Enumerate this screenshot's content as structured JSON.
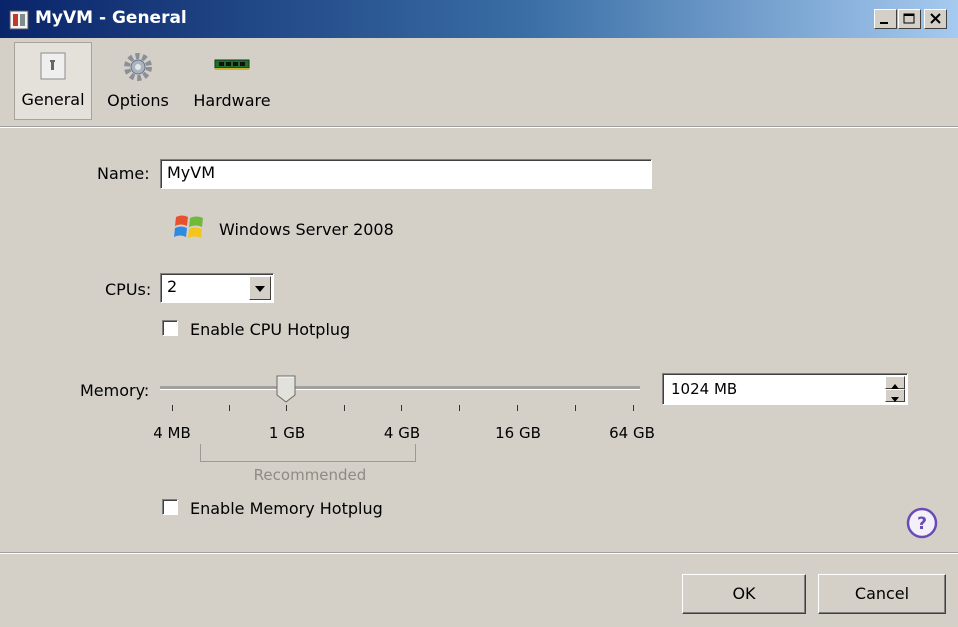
{
  "window": {
    "title": "MyVM - General"
  },
  "toolbar": {
    "tabs": [
      {
        "label": "General",
        "icon": "general-icon"
      },
      {
        "label": "Options",
        "icon": "options-gear-icon"
      },
      {
        "label": "Hardware",
        "icon": "hardware-memory-icon"
      }
    ]
  },
  "general": {
    "name_label": "Name:",
    "name_value": "MyVM",
    "os_name": "Windows Server 2008",
    "cpus_label": "CPUs:",
    "cpus_value": "2",
    "cpu_hotplug_label": "Enable CPU Hotplug",
    "cpu_hotplug_checked": false,
    "memory_label": "Memory:",
    "memory_value": "1024 MB",
    "memory_ticks": [
      "4 MB",
      "1 GB",
      "4 GB",
      "16 GB",
      "64 GB"
    ],
    "recommended_label": "Recommended",
    "memory_hotplug_label": "Enable Memory Hotplug",
    "memory_hotplug_checked": false
  },
  "footer": {
    "ok_label": "OK",
    "cancel_label": "Cancel"
  },
  "colors": {
    "titlebar_start": "#0a246a",
    "titlebar_end": "#a6caf0",
    "dialog_bg": "#d4d0c8",
    "help_icon": "#6a4bb5"
  }
}
